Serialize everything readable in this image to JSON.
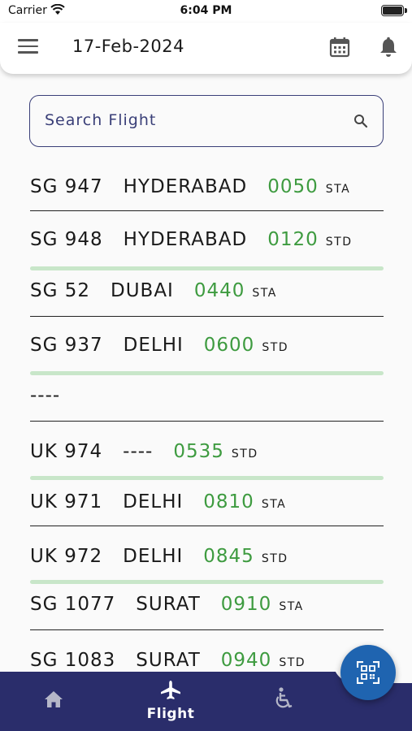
{
  "status_bar": {
    "carrier": "Carrier",
    "time": "6:04 PM"
  },
  "app_bar": {
    "date": "17-Feb-2024"
  },
  "search": {
    "placeholder": "Search Flight"
  },
  "flights": [
    {
      "code": "SG 947",
      "city": "HYDERABAD",
      "time": "0050",
      "type": "STA"
    },
    {
      "code": "SG 948",
      "city": "HYDERABAD",
      "time": "0120",
      "type": "STD"
    },
    {
      "code": "SG 52",
      "city": "DUBAI",
      "time": "0440",
      "type": "STA"
    },
    {
      "code": "SG 937",
      "city": "DELHI",
      "time": "0600",
      "type": "STD"
    },
    {
      "code": "----",
      "city": "",
      "time": "",
      "type": ""
    },
    {
      "code": "UK 974",
      "city": "----",
      "time": "0535",
      "type": "STD"
    },
    {
      "code": "UK 971",
      "city": "DELHI",
      "time": "0810",
      "type": "STA"
    },
    {
      "code": "UK 972",
      "city": "DELHI",
      "time": "0845",
      "type": "STD"
    },
    {
      "code": "SG 1077",
      "city": "SURAT",
      "time": "0910",
      "type": "STA"
    },
    {
      "code": "SG 1083",
      "city": "SURAT",
      "time": "0940",
      "type": "STD"
    }
  ],
  "bottom_nav": {
    "active_label": "Flight"
  },
  "colors": {
    "primary": "#2a2d6b",
    "time_green": "#3e9b40",
    "departure_rule": "#c8e6c9",
    "fab": "#1f64b0"
  },
  "icons": [
    "menu-icon",
    "calendar-icon",
    "bell-icon",
    "search-icon",
    "home-icon",
    "airplane-icon",
    "wheelchair-icon",
    "qr-scan-icon"
  ]
}
